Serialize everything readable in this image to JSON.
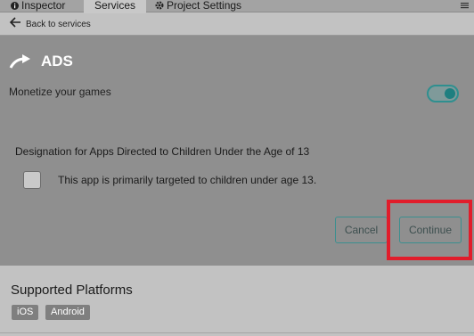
{
  "tabs": {
    "inspector": "Inspector",
    "services": "Services",
    "project_settings": "Project Settings"
  },
  "back_label": "Back to services",
  "ads": {
    "title": "ADS",
    "monetize_label": "Monetize your games",
    "monetize_enabled": true
  },
  "coppa": {
    "heading": "Designation for Apps Directed to Children Under the Age of 13",
    "checkbox_label": "This app is primarily targeted to children under age 13.",
    "checked": false
  },
  "buttons": {
    "cancel": "Cancel",
    "continue": "Continue"
  },
  "platforms": {
    "title": "Supported Platforms",
    "items": [
      "iOS",
      "Android"
    ]
  },
  "colors": {
    "accent": "#1e7f80",
    "highlight": "#e11d2b"
  }
}
